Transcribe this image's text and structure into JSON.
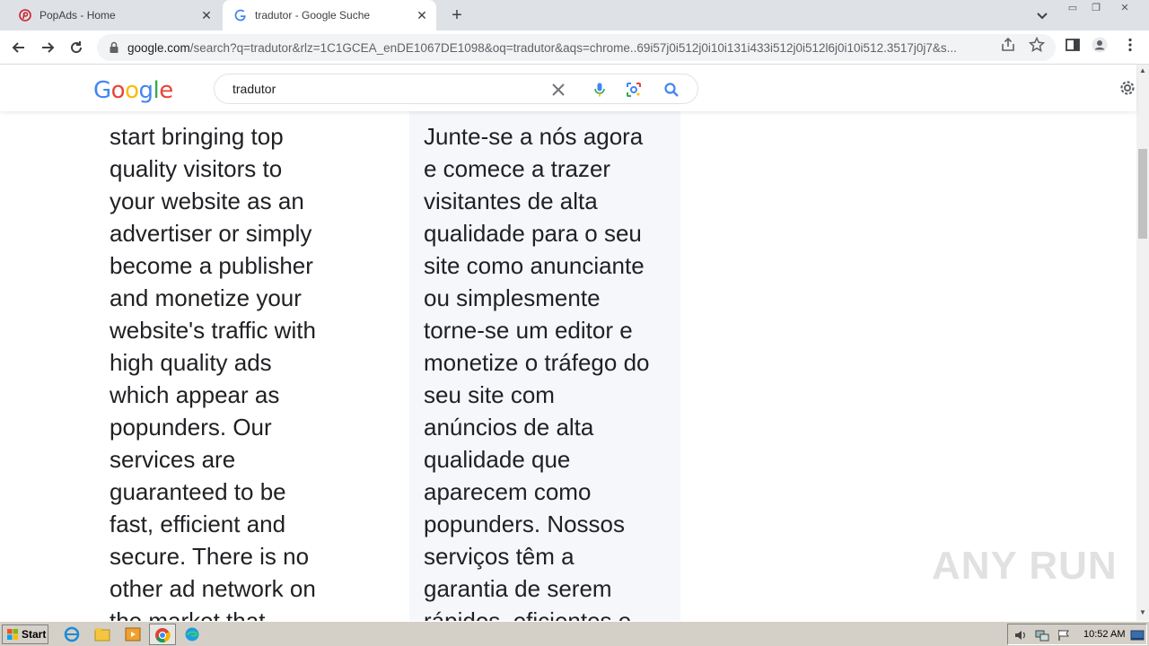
{
  "tabs": [
    {
      "title": "PopAds - Home",
      "active": false
    },
    {
      "title": "tradutor - Google Suche",
      "active": true
    }
  ],
  "address_bar": {
    "domain": "google.com",
    "path": "/search?q=tradutor&rlz=1C1GCEA_enDE1067DE1098&oq=tradutor&aqs=chrome..69i57j0i512j0i10i131i433i512j0i512l6j0i10i512.3517j0j7&s..."
  },
  "google": {
    "logo_text": "Google",
    "query": "tradutor"
  },
  "translation": {
    "source_lines": [
      "start bringing top",
      "quality visitors to",
      "your website as an",
      "advertiser or simply",
      "become a publisher",
      "and monetize your",
      "website's traffic with",
      "high quality ads",
      "which appear as",
      "popunders. Our",
      "services are",
      "guaranteed to be",
      "fast, efficient and",
      "secure. There is no",
      "other ad network on",
      "the market that"
    ],
    "target_lines": [
      "Junte-se a nós agora",
      "e comece a trazer",
      "visitantes de alta",
      "qualidade para o seu",
      "site como anunciante",
      "ou simplesmente",
      "torne-se um editor e",
      "monetize o tráfego do",
      "seu site com",
      "anúncios de alta",
      "qualidade que",
      "aparecem como",
      "popunders. Nossos",
      "serviços têm a",
      "garantia de serem",
      "rápidos, eficientes e"
    ]
  },
  "watermark": "ANY RUN",
  "taskbar": {
    "start_label": "Start",
    "clock": "10:52 AM"
  },
  "colors": {
    "google_blue": "#4285F4",
    "google_red": "#EA4335",
    "google_yellow": "#FBBC05",
    "google_green": "#34A853"
  }
}
